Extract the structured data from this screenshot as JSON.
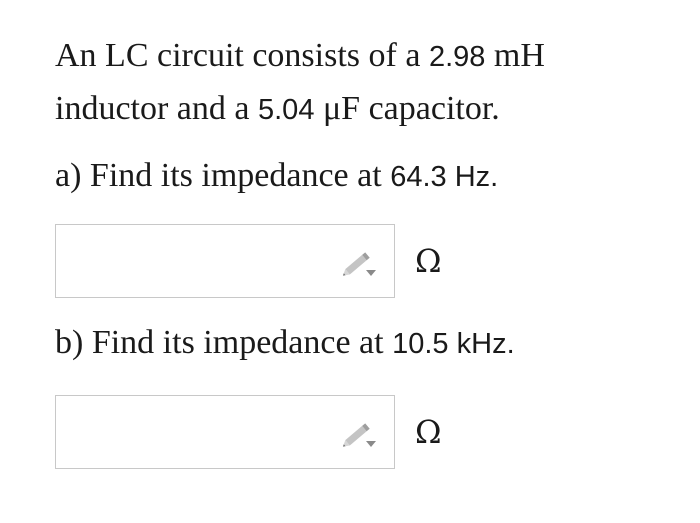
{
  "problem": {
    "intro_part1": "An LC circuit consists of a ",
    "inductance": "2.98",
    "inductance_unit": " mH",
    "intro_part2": "inductor and a ",
    "capacitance": "5.04",
    "capacitance_unit": " μF capacitor."
  },
  "part_a": {
    "label": "a) Find its impedance at ",
    "frequency": "64.3",
    "frequency_unit": " Hz.",
    "input_value": "",
    "unit": "Ω",
    "icon": "pencil-icon"
  },
  "part_b": {
    "label": "b) Find its impedance at ",
    "frequency": "10.5",
    "frequency_unit": " kHz.",
    "input_value": "",
    "unit": "Ω",
    "icon": "pencil-icon"
  }
}
